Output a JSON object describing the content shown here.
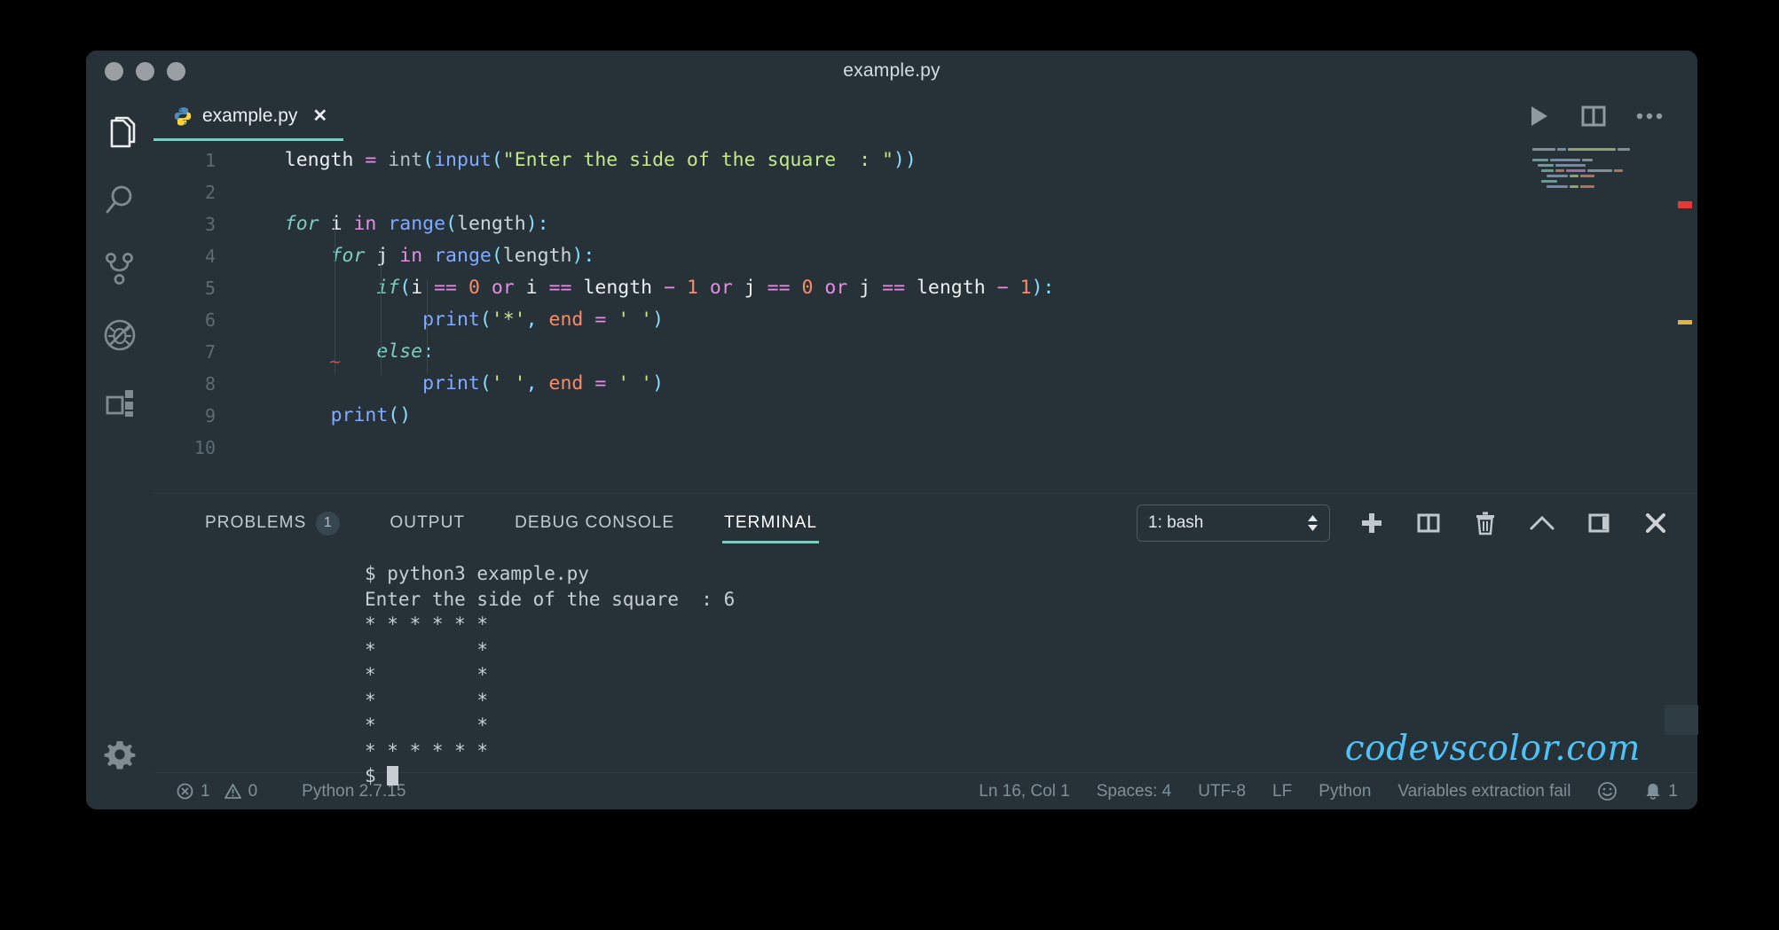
{
  "window": {
    "title": "example.py",
    "traffic_lights": [
      "close",
      "minimize",
      "maximize"
    ]
  },
  "activity_bar": {
    "items": [
      {
        "name": "explorer",
        "icon": "files-icon",
        "active": true
      },
      {
        "name": "search",
        "icon": "search-icon",
        "active": false
      },
      {
        "name": "source-control",
        "icon": "source-control-icon",
        "active": false
      },
      {
        "name": "run-debug",
        "icon": "debug-disabled-icon",
        "active": false
      },
      {
        "name": "extensions",
        "icon": "extensions-icon",
        "active": false
      }
    ],
    "settings": {
      "name": "manage",
      "icon": "gear-icon"
    }
  },
  "editor": {
    "tab": {
      "label": "example.py",
      "icon": "python-icon",
      "close": "✕",
      "active": true
    },
    "actions": [
      {
        "name": "run-file",
        "icon": "play-icon"
      },
      {
        "name": "split-editor",
        "icon": "split-editor-icon"
      },
      {
        "name": "more-actions",
        "icon": "ellipsis-icon"
      }
    ],
    "lines": [
      {
        "n": "1",
        "tokens": [
          {
            "t": "    ",
            "c": "t-plain"
          },
          {
            "t": "length",
            "c": "t-var"
          },
          {
            "t": " ",
            "c": "t-plain"
          },
          {
            "t": "=",
            "c": "t-op"
          },
          {
            "t": " ",
            "c": "t-plain"
          },
          {
            "t": "int",
            "c": "t-built"
          },
          {
            "t": "(",
            "c": "t-punct"
          },
          {
            "t": "input",
            "c": "t-fn"
          },
          {
            "t": "(",
            "c": "t-punct"
          },
          {
            "t": "\"Enter the side of the square  : \"",
            "c": "t-str"
          },
          {
            "t": "))",
            "c": "t-punct"
          }
        ]
      },
      {
        "n": "2",
        "tokens": []
      },
      {
        "n": "3",
        "tokens": [
          {
            "t": "    ",
            "c": "t-plain"
          },
          {
            "t": "for",
            "c": "t-kw"
          },
          {
            "t": " ",
            "c": "t-plain"
          },
          {
            "t": "i",
            "c": "t-var"
          },
          {
            "t": " ",
            "c": "t-plain"
          },
          {
            "t": "in",
            "c": "t-op"
          },
          {
            "t": " ",
            "c": "t-plain"
          },
          {
            "t": "range",
            "c": "t-fn"
          },
          {
            "t": "(",
            "c": "t-punct"
          },
          {
            "t": "length",
            "c": "t-id"
          },
          {
            "t": ")",
            "c": "t-punct"
          },
          {
            "t": ":",
            "c": "t-punct"
          }
        ]
      },
      {
        "n": "4",
        "tokens": [
          {
            "t": "        ",
            "c": "t-plain"
          },
          {
            "t": "for",
            "c": "t-kw"
          },
          {
            "t": " ",
            "c": "t-plain"
          },
          {
            "t": "j",
            "c": "t-var"
          },
          {
            "t": " ",
            "c": "t-plain"
          },
          {
            "t": "in",
            "c": "t-op"
          },
          {
            "t": " ",
            "c": "t-plain"
          },
          {
            "t": "range",
            "c": "t-fn"
          },
          {
            "t": "(",
            "c": "t-punct"
          },
          {
            "t": "length",
            "c": "t-id"
          },
          {
            "t": ")",
            "c": "t-punct"
          },
          {
            "t": ":",
            "c": "t-punct"
          }
        ]
      },
      {
        "n": "5",
        "tokens": [
          {
            "t": "            ",
            "c": "t-plain"
          },
          {
            "t": "if",
            "c": "t-kw"
          },
          {
            "t": "(",
            "c": "t-punct"
          },
          {
            "t": "i",
            "c": "t-var"
          },
          {
            "t": " ",
            "c": "t-plain"
          },
          {
            "t": "==",
            "c": "t-op"
          },
          {
            "t": " ",
            "c": "t-plain"
          },
          {
            "t": "0",
            "c": "t-num"
          },
          {
            "t": " ",
            "c": "t-plain"
          },
          {
            "t": "or",
            "c": "t-op"
          },
          {
            "t": " ",
            "c": "t-plain"
          },
          {
            "t": "i",
            "c": "t-var"
          },
          {
            "t": " ",
            "c": "t-plain"
          },
          {
            "t": "==",
            "c": "t-op"
          },
          {
            "t": " ",
            "c": "t-plain"
          },
          {
            "t": "length",
            "c": "t-var"
          },
          {
            "t": " ",
            "c": "t-plain"
          },
          {
            "t": "−",
            "c": "t-op"
          },
          {
            "t": " ",
            "c": "t-plain"
          },
          {
            "t": "1",
            "c": "t-num"
          },
          {
            "t": " ",
            "c": "t-plain"
          },
          {
            "t": "or",
            "c": "t-op"
          },
          {
            "t": " ",
            "c": "t-plain"
          },
          {
            "t": "j",
            "c": "t-var"
          },
          {
            "t": " ",
            "c": "t-plain"
          },
          {
            "t": "==",
            "c": "t-op"
          },
          {
            "t": " ",
            "c": "t-plain"
          },
          {
            "t": "0",
            "c": "t-num"
          },
          {
            "t": " ",
            "c": "t-plain"
          },
          {
            "t": "or",
            "c": "t-op"
          },
          {
            "t": " ",
            "c": "t-plain"
          },
          {
            "t": "j",
            "c": "t-var"
          },
          {
            "t": " ",
            "c": "t-plain"
          },
          {
            "t": "==",
            "c": "t-op"
          },
          {
            "t": " ",
            "c": "t-plain"
          },
          {
            "t": "length",
            "c": "t-var"
          },
          {
            "t": " ",
            "c": "t-plain"
          },
          {
            "t": "−",
            "c": "t-op"
          },
          {
            "t": " ",
            "c": "t-plain"
          },
          {
            "t": "1",
            "c": "t-num"
          },
          {
            "t": ")",
            "c": "t-punct"
          },
          {
            "t": ":",
            "c": "t-punct"
          }
        ]
      },
      {
        "n": "6",
        "tokens": [
          {
            "t": "                ",
            "c": "t-plain"
          },
          {
            "t": "print",
            "c": "t-fn"
          },
          {
            "t": "(",
            "c": "t-punct"
          },
          {
            "t": "'*'",
            "c": "t-str"
          },
          {
            "t": ",",
            "c": "t-punct"
          },
          {
            "t": " ",
            "c": "t-plain"
          },
          {
            "t": "end",
            "c": "t-param"
          },
          {
            "t": " ",
            "c": "t-plain"
          },
          {
            "t": "=",
            "c": "t-op"
          },
          {
            "t": " ",
            "c": "t-plain"
          },
          {
            "t": "' '",
            "c": "t-str"
          },
          {
            "t": ")",
            "c": "t-punct"
          }
        ]
      },
      {
        "n": "7",
        "tokens": [
          {
            "t": "            ",
            "c": "t-plain"
          },
          {
            "t": "else",
            "c": "t-kw"
          },
          {
            "t": ":",
            "c": "t-punct"
          }
        ]
      },
      {
        "n": "8",
        "tokens": [
          {
            "t": "                ",
            "c": "t-plain"
          },
          {
            "t": "print",
            "c": "t-fn"
          },
          {
            "t": "(",
            "c": "t-punct"
          },
          {
            "t": "' '",
            "c": "t-str"
          },
          {
            "t": ",",
            "c": "t-punct"
          },
          {
            "t": " ",
            "c": "t-plain"
          },
          {
            "t": "end",
            "c": "t-param"
          },
          {
            "t": " ",
            "c": "t-plain"
          },
          {
            "t": "=",
            "c": "t-op"
          },
          {
            "t": " ",
            "c": "t-plain"
          },
          {
            "t": "' '",
            "c": "t-str"
          },
          {
            "t": ")",
            "c": "t-punct"
          }
        ]
      },
      {
        "n": "9",
        "tokens": [
          {
            "t": "        ",
            "c": "t-plain"
          },
          {
            "t": "print",
            "c": "t-fn"
          },
          {
            "t": "(",
            "c": "t-punct"
          },
          {
            "t": ")",
            "c": "t-punct"
          }
        ]
      },
      {
        "n": "10",
        "tokens": []
      }
    ],
    "plain_text": [
      "    length = int(input(\"Enter the side of the square  : \"))",
      "",
      "    for i in range(length):",
      "        for j in range(length):",
      "            if(i == 0 or i == length - 1 or j == 0 or j == length - 1):",
      "                print('*', end = ' ')",
      "            else:",
      "                print(' ', end = ' ')",
      "        print()",
      ""
    ]
  },
  "panel": {
    "tabs": [
      {
        "label": "PROBLEMS",
        "badge": "1",
        "active": false
      },
      {
        "label": "OUTPUT",
        "badge": null,
        "active": false
      },
      {
        "label": "DEBUG CONSOLE",
        "badge": null,
        "active": false
      },
      {
        "label": "TERMINAL",
        "badge": null,
        "active": true
      }
    ],
    "terminal_select": {
      "value": "1: bash"
    },
    "tools": [
      {
        "name": "new-terminal",
        "icon": "plus-icon"
      },
      {
        "name": "split-terminal",
        "icon": "split-icon"
      },
      {
        "name": "kill-terminal",
        "icon": "trash-icon"
      },
      {
        "name": "maximize-panel",
        "icon": "chevron-up-icon"
      },
      {
        "name": "toggle-sidebar",
        "icon": "panel-icon"
      },
      {
        "name": "close-panel",
        "icon": "close-icon"
      }
    ],
    "terminal_output": [
      "$ python3 example.py",
      "Enter the side of the square  : 6",
      "* * * * * * ",
      "*         * ",
      "*         * ",
      "*         * ",
      "*         * ",
      "* * * * * * ",
      "$ "
    ],
    "watermark": "codevscolor.com"
  },
  "status_bar": {
    "errors": "1",
    "warnings": "0",
    "interpreter": "Python 2.7.15",
    "position": "Ln 16, Col 1",
    "indentation": "Spaces: 4",
    "encoding": "UTF-8",
    "eol": "LF",
    "language": "Python",
    "message": "Variables extraction fail",
    "feedback_icon": "smiley-icon",
    "notifications": "1"
  },
  "colors": {
    "background": "#263238",
    "accent": "#80cbc4",
    "watermark": "#4fc3f7",
    "string": "#c3e88d",
    "number": "#f78c6c",
    "operator": "#e38fe3",
    "function": "#82aaff",
    "keyword": "#80cbc4",
    "status_text": "#7e909a"
  }
}
